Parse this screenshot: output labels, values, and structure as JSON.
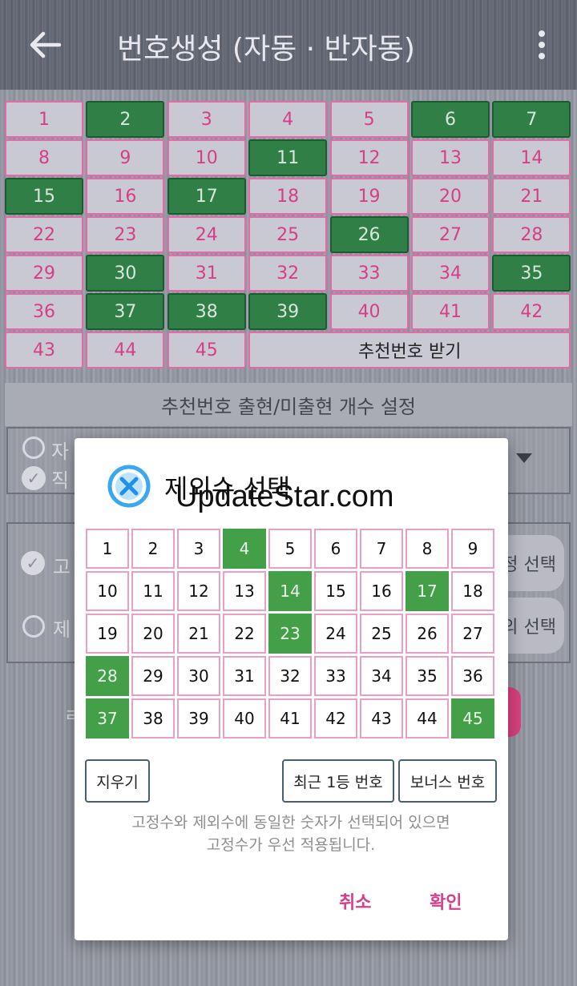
{
  "appbar": {
    "title": "번호생성 (자동 · 반자동)"
  },
  "main_grid": {
    "numbers": [
      1,
      2,
      3,
      4,
      5,
      6,
      7,
      8,
      9,
      10,
      11,
      12,
      13,
      14,
      15,
      16,
      17,
      18,
      19,
      20,
      21,
      22,
      23,
      24,
      25,
      26,
      27,
      28,
      29,
      30,
      31,
      32,
      33,
      34,
      35,
      36,
      37,
      38,
      39,
      40,
      41,
      42,
      43,
      44,
      45
    ],
    "selected": [
      2,
      6,
      7,
      11,
      15,
      17,
      26,
      30,
      35,
      37,
      38,
      39
    ],
    "recommend_label": "추천번호 받기"
  },
  "section": {
    "title": "추천번호 출현/미출현 개수 설정"
  },
  "background_partial": {
    "option1": "자",
    "option2": "직",
    "option3": "고",
    "option4": "제",
    "pill1": "정 선택",
    "pill2": "의 선택",
    "left_char": "ㄹ"
  },
  "dialog": {
    "title": "제외수 선택",
    "watermark": "UpdateStar.com",
    "numbers": [
      1,
      2,
      3,
      4,
      5,
      6,
      7,
      8,
      9,
      10,
      11,
      12,
      13,
      14,
      15,
      16,
      17,
      18,
      19,
      20,
      21,
      22,
      23,
      24,
      25,
      26,
      27,
      28,
      29,
      30,
      31,
      32,
      33,
      34,
      35,
      36,
      37,
      38,
      39,
      40,
      41,
      42,
      43,
      44,
      45
    ],
    "selected": [
      4,
      14,
      17,
      23,
      28,
      37,
      45
    ],
    "clear_label": "지우기",
    "recent_label": "최근 1등 번호",
    "bonus_label": "보너스 번호",
    "notice_line1": "고정수와 제외수에 동일한 숫자가 선택되어 있으면",
    "notice_line2": "고정수가 우선 적용됩니다.",
    "cancel_label": "취소",
    "confirm_label": "확인"
  },
  "colors": {
    "selected_main": "#2f7f46",
    "selected_dialog": "#43a048",
    "accent_pink": "#d63e88"
  }
}
